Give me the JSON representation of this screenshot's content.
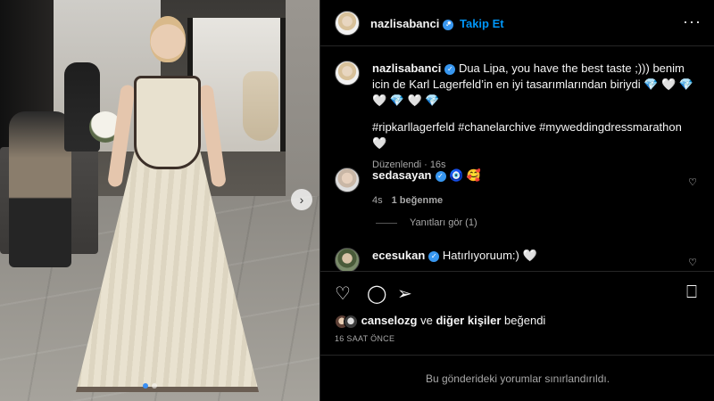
{
  "post": {
    "username": "nazlisabanci",
    "follow_label": "Takip Et",
    "separator": "•",
    "more_icon": "more-horizontal-icon"
  },
  "caption": {
    "username": "nazlisabanci",
    "text": "Dua Lipa, you have the best taste ;))) benim icin de Karl Lagerfeld’in en iyi tasarımlarından biriydi 💎 🤍 💎 🤍 💎 🤍 💎",
    "hashtags": "#ripkarllagerfeld #chanelarchive #myweddingdressmarathon 🤍",
    "edited": "Düzenlendi · 16s"
  },
  "comments": [
    {
      "username": "sedasayan",
      "text": "🧿 🥰",
      "time": "4s",
      "likes": "1 beğenme",
      "replies": "Yanıtları gör (1)"
    },
    {
      "username": "ecesukan",
      "text": "Hatırlıyoruum:) 🤍"
    }
  ],
  "likes_line": {
    "user": "canselozg",
    "mid": " ve ",
    "others": "diğer kişiler",
    "end": " beğendi"
  },
  "timestamp": "16 SAAT ÖNCE",
  "restricted_text": "Bu gönderideki yorumlar sınırlandırıldı.",
  "icons": [
    "heart-icon",
    "comment-icon",
    "share-icon",
    "bookmark-icon",
    "chevron-right-icon"
  ],
  "colors": {
    "accent": "#0095f6",
    "verified": "#3897f0",
    "background": "#000000"
  }
}
